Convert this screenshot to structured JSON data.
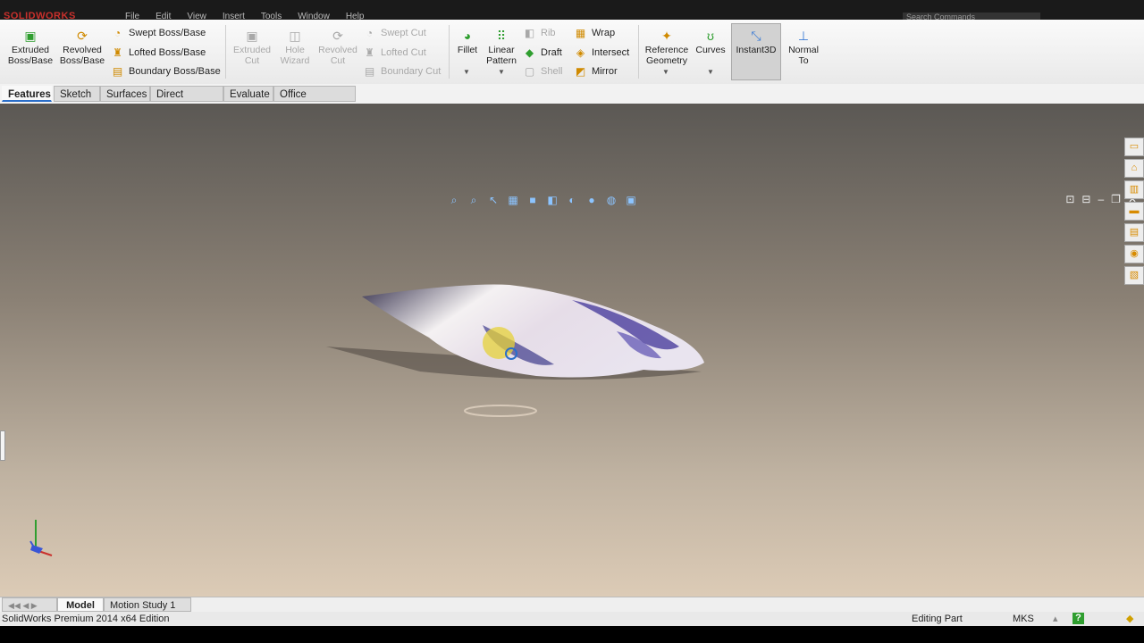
{
  "app": {
    "logo": "SOLIDWORKS",
    "menu": [
      "File",
      "Edit",
      "View",
      "Insert",
      "Tools",
      "Window",
      "Help"
    ],
    "search_placeholder": "Search Commands"
  },
  "ribbon": {
    "extruded_boss": "Extruded Boss/Base",
    "revolved_boss": "Revolved Boss/Base",
    "swept_boss": "Swept Boss/Base",
    "lofted_boss": "Lofted Boss/Base",
    "boundary_boss": "Boundary Boss/Base",
    "extruded_cut": "Extruded Cut",
    "hole_wizard": "Hole Wizard",
    "revolved_cut": "Revolved Cut",
    "swept_cut": "Swept Cut",
    "lofted_cut": "Lofted Cut",
    "boundary_cut": "Boundary Cut",
    "fillet": "Fillet",
    "linear_pattern": "Linear Pattern",
    "rib": "Rib",
    "draft": "Draft",
    "shell": "Shell",
    "wrap": "Wrap",
    "intersect": "Intersect",
    "mirror": "Mirror",
    "reference_geometry": "Reference Geometry",
    "curves": "Curves",
    "instant3d": "Instant3D",
    "normal_to": "Normal To"
  },
  "tabs": [
    "Features",
    "Sketch",
    "Surfaces",
    "Direct Editing",
    "Evaluate",
    "Office Products"
  ],
  "bottom_tabs": [
    "Model",
    "Motion Study 1"
  ],
  "status": {
    "edition": "SolidWorks Premium 2014 x64 Edition",
    "mode": "Editing Part",
    "units": "MKS"
  },
  "colors": {
    "accent": "#2a6ec9",
    "viewport_top": "#5b5854",
    "viewport_bottom": "#dccbb6",
    "icon_green": "#2f9e2f",
    "icon_yellow": "#e0a800"
  }
}
